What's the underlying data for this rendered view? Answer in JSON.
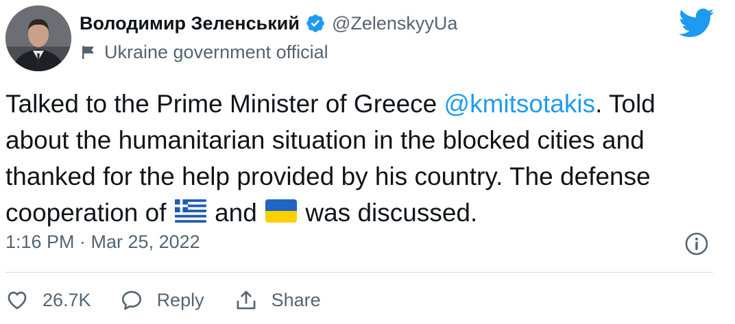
{
  "author": {
    "display_name": "Володимир Зеленський",
    "handle": "@ZelenskyyUa",
    "label": "Ukraine government official"
  },
  "tweet": {
    "text_part1": "Talked to the Prime Minister of Greece ",
    "mention": "@kmitsotakis",
    "text_part2": ". Told about the humanitarian situation in the blocked cities and thanked for the help provided by his country. The defense cooperation of ",
    "text_part3": " and ",
    "text_part4": " was discussed.",
    "emoji_1": "greece-flag",
    "emoji_2": "ukraine-flag"
  },
  "timestamp": "1:16 PM · Mar 25, 2022",
  "actions": {
    "like_count": "26.7K",
    "reply_label": "Reply",
    "share_label": "Share"
  },
  "icons": {
    "brand": "twitter-bird-icon",
    "verified": "verified-badge-icon",
    "label": "flag-icon",
    "info": "info-icon",
    "like": "heart-icon",
    "reply": "reply-bubble-icon",
    "share": "share-icon"
  },
  "colors": {
    "accent": "#1d9bf0",
    "text": "#0f1419",
    "secondary": "#536471",
    "divider": "#cfd9de",
    "greece_blue": "#1f5bb5",
    "ukraine_blue": "#1f66c4",
    "ukraine_yellow": "#ffd000"
  }
}
